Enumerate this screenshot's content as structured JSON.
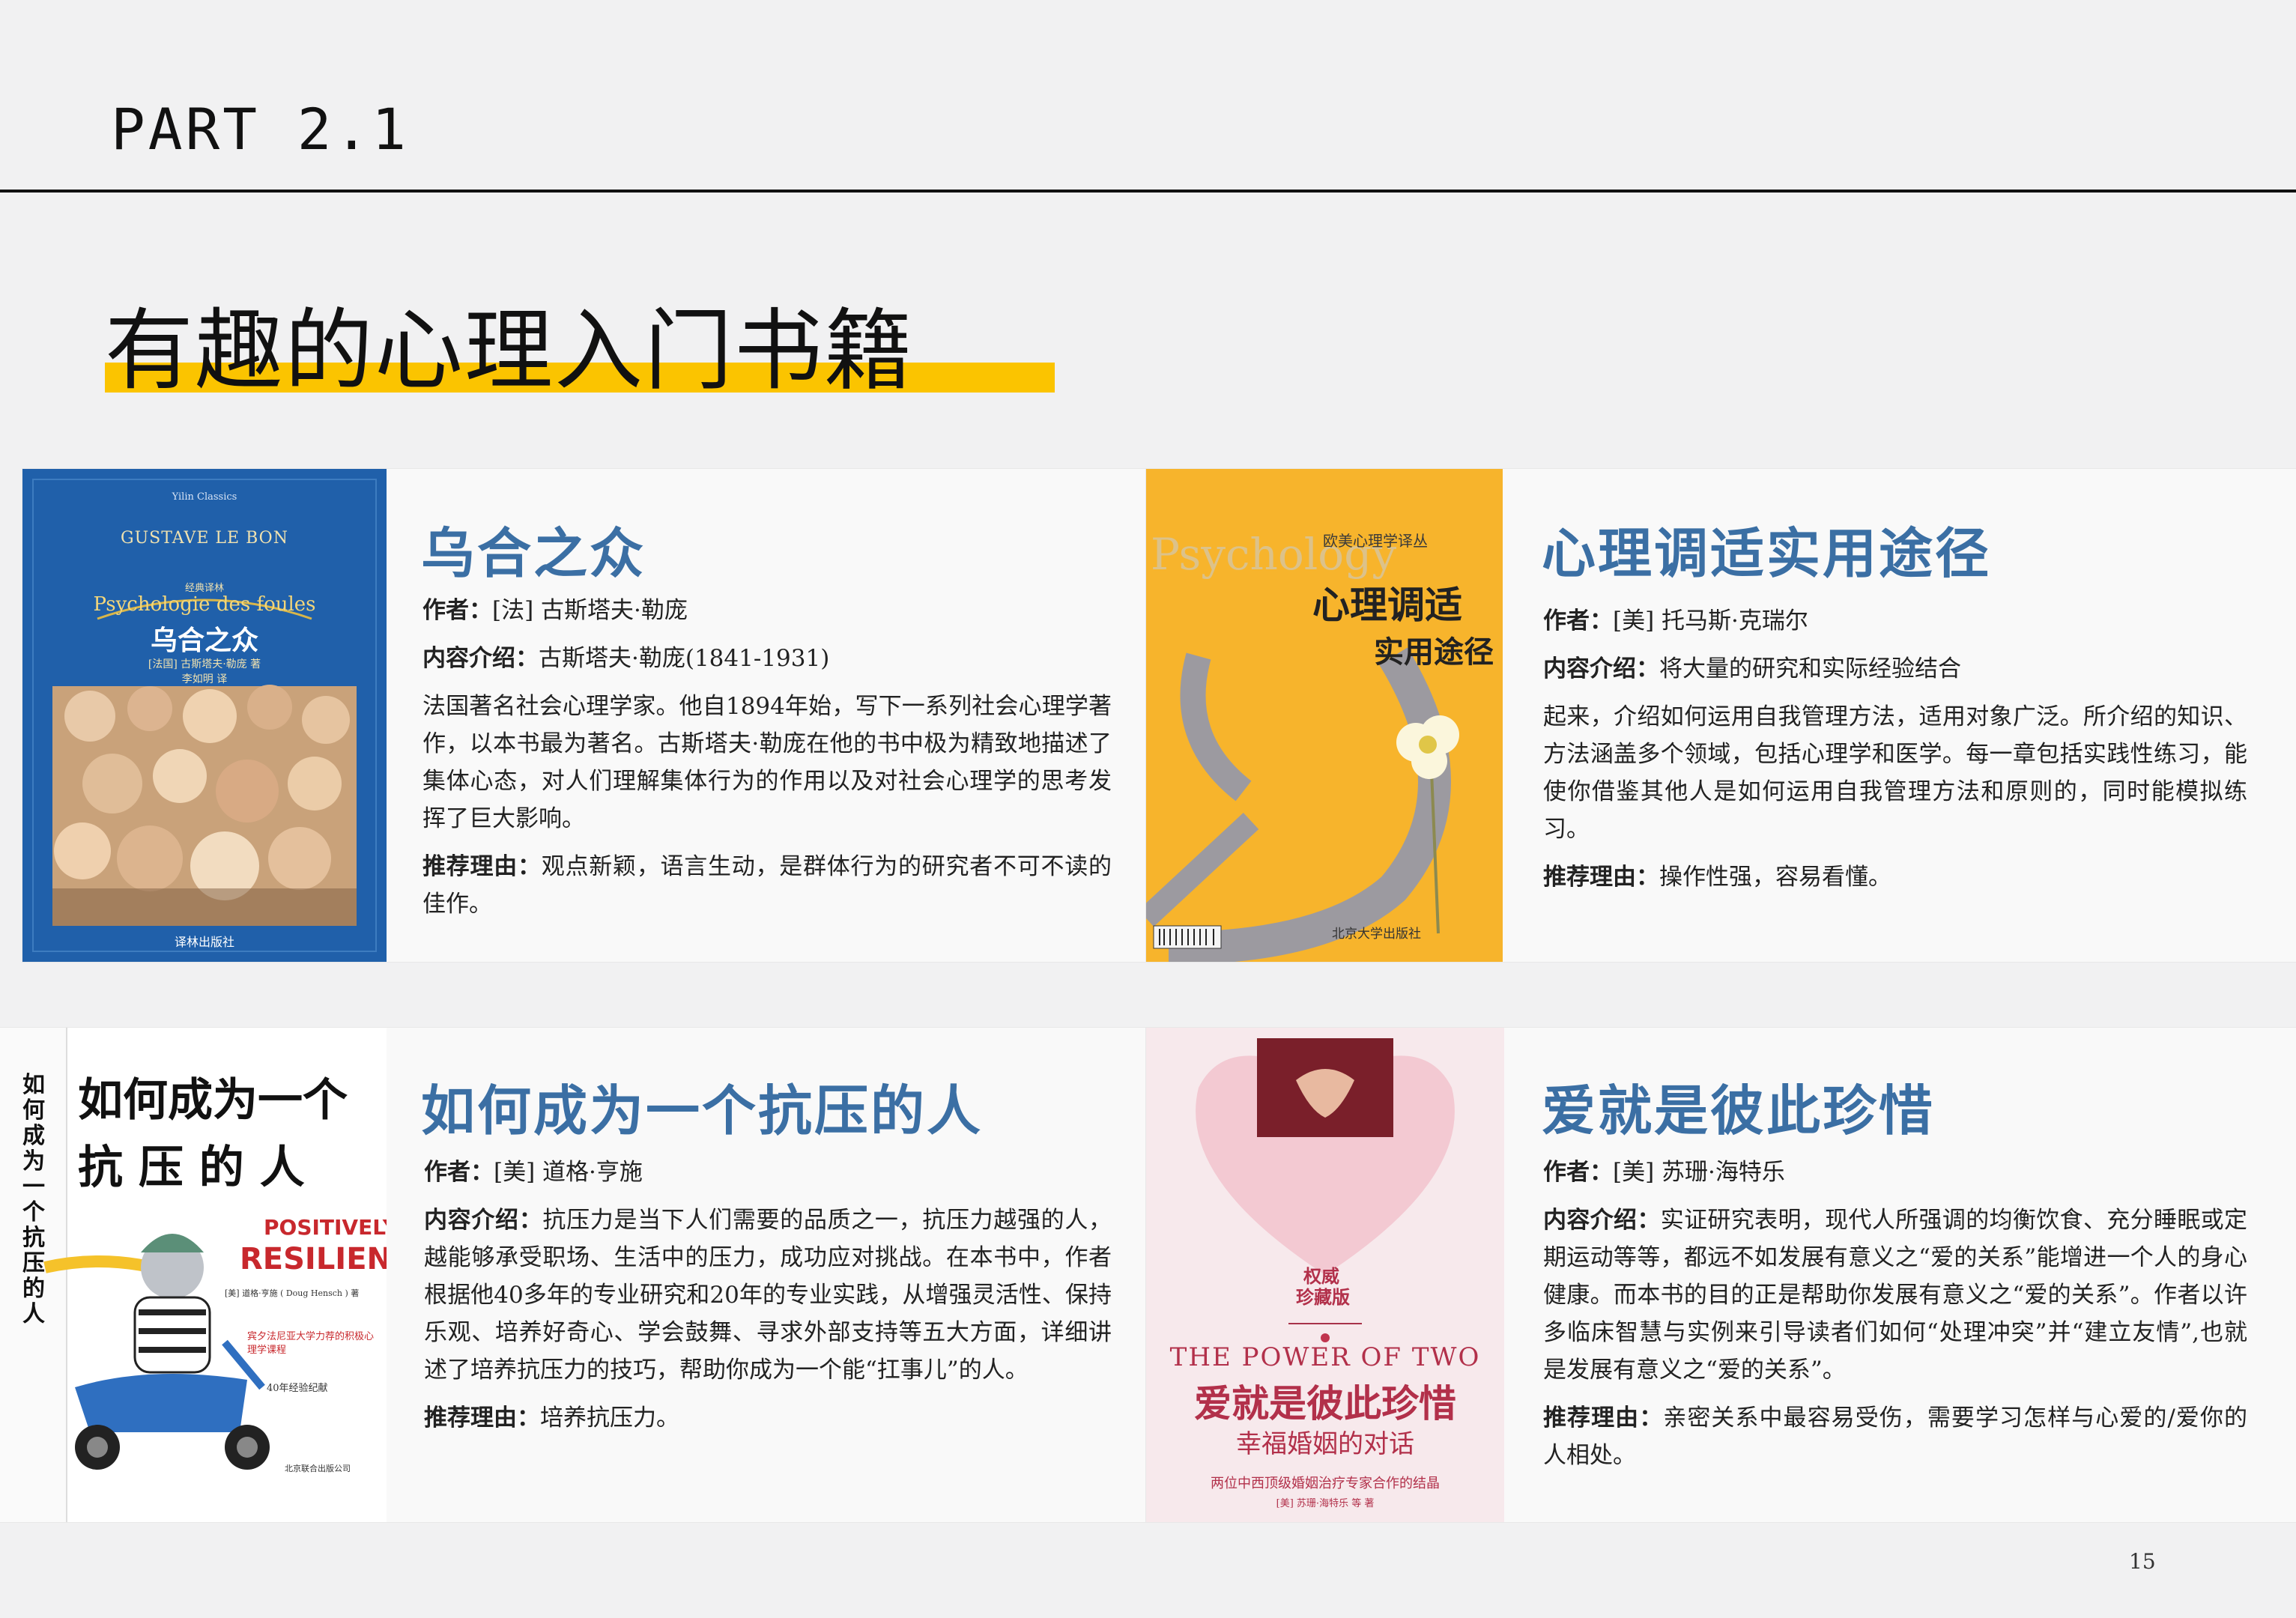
{
  "header": {
    "part": "PART 2.1",
    "title": "有趣的心理入门书籍"
  },
  "accent_color": "#fbc400",
  "title_color": "#3b6fa4",
  "labels": {
    "author": "作者：",
    "intro": "内容介绍：",
    "reason": "推荐理由："
  },
  "books": [
    {
      "title": "乌合之众",
      "author": "[法] 古斯塔夫·勒庞",
      "intro_lines": [
        "古斯塔夫·勒庞(1841-1931)",
        "法国著名社会心理学家。他自1894年始，写下一系列社会心理学著作，以本书最为著名。古斯塔夫·勒庞在他的书中极为精致地描述了集体心态，对人们理解集体行为的作用以及对社会心理学的思考发挥了巨大影响。"
      ],
      "reason": "观点新颖，语言生动，是群体行为的研究者不可不读的佳作。",
      "cover": {
        "series": "Yilin Classics",
        "author_en": "GUSTAVE LE BON",
        "title_fr": "Psychologie des foules",
        "subtitle": "经典译林",
        "title_cn": "乌合之众",
        "credit": "[法国] 古斯塔夫·勒庞 著",
        "translator": "李如明 译",
        "publisher": "译林出版社"
      }
    },
    {
      "title": "心理调适实用途径",
      "author": "[美] 托马斯·克瑞尔",
      "intro_lines": [
        "将大量的研究和实际经验结合",
        "起来，介绍如何运用自我管理方法，适用对象广泛。所介绍的知识、方法涵盖多个领域，包括心理学和医学。每一章包括实践性练习，能使你借鉴其他人是如何运用自我管理方法和原则的，同时能模拟练习。"
      ],
      "reason": "操作性强，容易看懂。",
      "cover": {
        "watermark": "Psychology",
        "series": "欧美心理学译丛",
        "title_line1": "心理调适",
        "title_line2": "实用途径",
        "publisher": "北京大学出版社"
      }
    },
    {
      "title": "如何成为一个抗压的人",
      "author": "[美] 道格·亨施",
      "intro_lines": [
        "抗压力是当下人们需要的品质之一，抗压力越强的人，越能够承受职场、生活中的压力，成功应对挑战。在本书中，作者根据他40多年的专业研究和20年的专业实践，从增强灵活性、保持乐观、培养好奇心、学会鼓舞、寻求外部支持等五大方面，详细讲述了培养抗压力的技巧，帮助你成为一个能“扛事儿”的人。"
      ],
      "reason": "培养抗压力。",
      "cover": {
        "title_line1": "如何成为一个",
        "title_line2": "抗 压 的 人",
        "spine": "如何成为一个抗压的人",
        "en_line1": "POSITIVELY",
        "en_line2": "RESILIENT",
        "credit": "[美] 道格·亨施 ( Doug Hensch ) 著",
        "tagline": "宾夕法尼亚大学力荐的积极心理学课程",
        "note": "40年经验纪献",
        "publisher": "北京联合出版公司"
      }
    },
    {
      "title": "爱就是彼此珍惜",
      "author": "[美] 苏珊·海特乐",
      "intro_lines": [
        "实证研究表明，现代人所强调的均衡饮食、充分睡眠或定期运动等等，都远不如发展有意义之“爱的关系”能增进一个人的身心健康。而本书的目的正是帮助你发展有意义之“爱的关系”。作者以许多临床智慧与实例来引导读者们如何“处理冲突”并“建立友情”,也就是发展有意义之“爱的关系”。"
      ],
      "reason": "亲密关系中最容易受伤，需要学习怎样与心爱的/爱你的人相处。",
      "cover": {
        "badge_line1": "权威",
        "badge_line2": "珍藏版",
        "en_title": "THE POWER OF TWO",
        "title_cn": "爱就是彼此珍惜",
        "subtitle": "幸福婚姻的对话",
        "tagline": "两位中西顶级婚姻治疗专家合作的结晶",
        "credit": "[美] 苏珊·海特乐 等 著"
      }
    }
  ],
  "page_number": "15"
}
